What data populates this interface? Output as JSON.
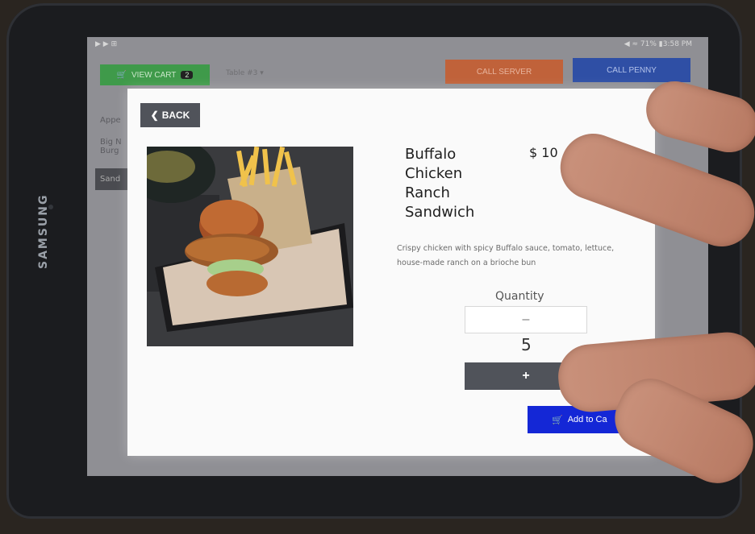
{
  "status": {
    "left_icons": "▶ ▶ ⊞",
    "right_text": "◀ ≈ 71% ▮3:58 PM"
  },
  "appbar": {
    "view_cart_label": "VIEW CART",
    "cart_count": "2",
    "table_select": "Table #3 ▾",
    "call_server_label": "CALL SERVER",
    "call_penny_label": "CALL PENNY"
  },
  "sidebar": {
    "items": [
      "Appe",
      "Big N Burg",
      "Sand"
    ]
  },
  "device": {
    "brand": "SAMSUNG"
  },
  "modal": {
    "back_label": "BACK",
    "item_name": "Buffalo Chicken Ranch Sandwich",
    "price": "$ 10",
    "description": "Crispy chicken with spicy Buffalo sauce, tomato, lettuce, house-made ranch on a brioche bun",
    "quantity_label": "Quantity",
    "minus_label": "–",
    "quantity_value": "5",
    "plus_label": "+",
    "add_to_cart_label": "Add to Ca"
  },
  "colors": {
    "view_cart": "#3f9a4a",
    "call_server": "#c0623a",
    "call_penny": "#2f4fa5",
    "add_to_cart": "#1427d6",
    "dark_button": "#50535a"
  },
  "icons": [
    "cart-icon",
    "chevron-left-icon"
  ]
}
